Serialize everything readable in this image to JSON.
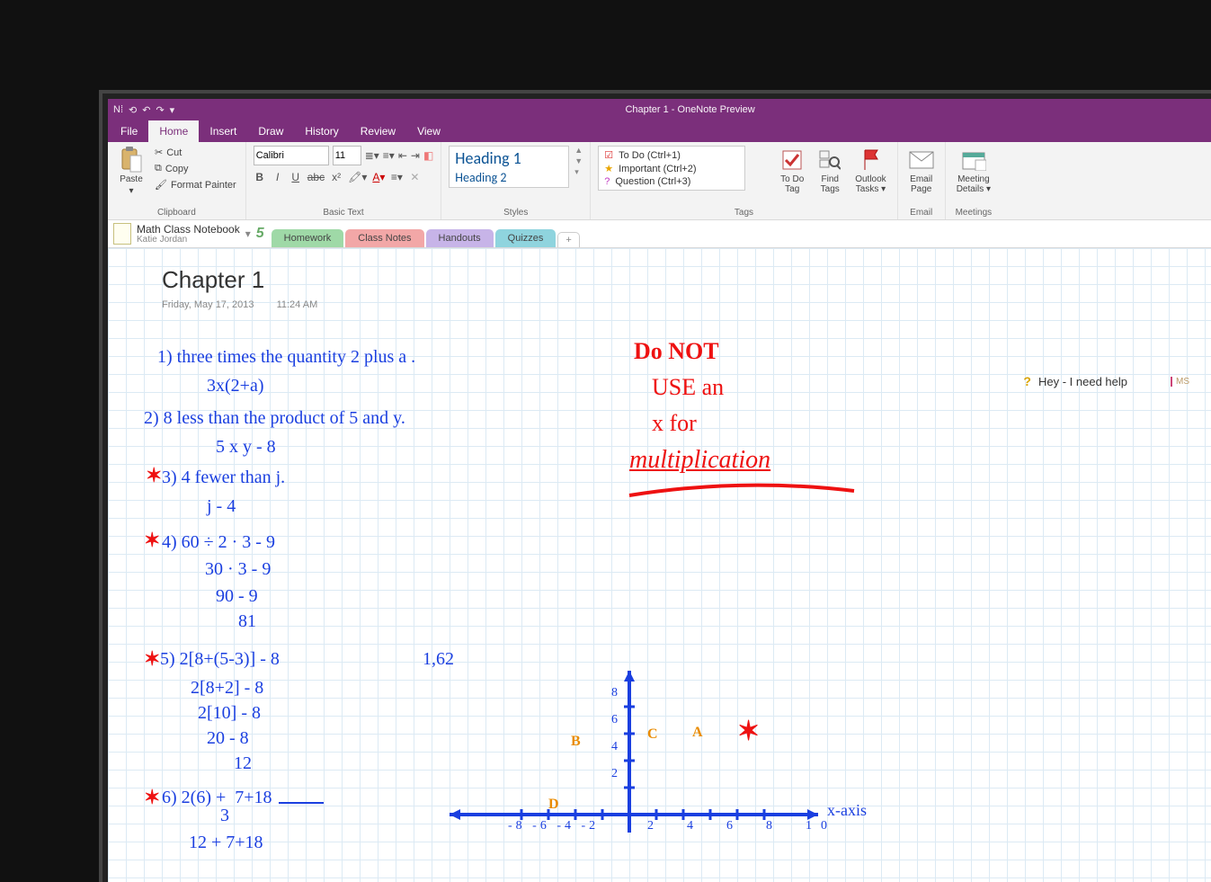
{
  "window": {
    "title": "Chapter 1  - OneNote Preview"
  },
  "ribbon_tabs": {
    "file": "File",
    "home": "Home",
    "insert": "Insert",
    "draw": "Draw",
    "history": "History",
    "review": "Review",
    "view": "View"
  },
  "clipboard": {
    "paste": "Paste",
    "cut": "Cut",
    "copy": "Copy",
    "fp": "Format Painter",
    "label": "Clipboard"
  },
  "basic_text": {
    "font": "Calibri",
    "size": "11",
    "label": "Basic Text"
  },
  "styles": {
    "h1": "Heading 1",
    "h2": "Heading 2",
    "label": "Styles"
  },
  "tags": {
    "todo": "To Do (Ctrl+1)",
    "important": "Important (Ctrl+2)",
    "question": "Question (Ctrl+3)",
    "todo_btn": "To Do\nTag",
    "find_btn": "Find\nTags",
    "outlook_btn": "Outlook\nTasks",
    "label": "Tags"
  },
  "email": {
    "btn": "Email\nPage",
    "label": "Email"
  },
  "meetings": {
    "btn": "Meeting\nDetails",
    "label": "Meetings"
  },
  "notebook": {
    "name": "Math Class Notebook",
    "owner": "Katie Jordan",
    "badge": "5"
  },
  "sections": {
    "homework": "Homework",
    "classnotes": "Class Notes",
    "handouts": "Handouts",
    "quizzes": "Quizzes",
    "add": "+"
  },
  "page": {
    "title": "Chapter 1",
    "date": "Friday, May 17, 2013",
    "time": "11:24 AM"
  },
  "ink": {
    "l1": "1) three times the quantity 2 plus a .",
    "l1b": "3x(2+a)",
    "l2": "2) 8 less than the product of 5 and y.",
    "l2b": "5 x y - 8",
    "l3": "3) 4 fewer than j.",
    "l3b": "j - 4",
    "l4": "4) 60 ÷ 2 · 3 - 9",
    "l4b": "30 · 3 - 9",
    "l4c": "90 - 9",
    "l4d": "81",
    "l5": "5) 2[8+(5-3)] - 8",
    "l5b": "2[8+2] - 8",
    "l5c": "2[10] - 8",
    "l5d": "20 - 8",
    "l5e": "12",
    "l6": "6) 2(6) +  7+18",
    "l6b": "             3",
    "l6c": "12 + 7+18",
    "extra": "1,62",
    "red1": "Do NOT",
    "red2": "USE an",
    "red3": "x for",
    "red4": "multiplication",
    "axis": "x-axis",
    "axisnums_pos": "2  4  6  8  10",
    "axisnums_neg": "-8 -6 -4 -2",
    "axisnums_y": "8\n6\n4\n2",
    "ptA": "A",
    "ptB": "B",
    "ptC": "C",
    "ptD": "D"
  },
  "side_note": {
    "text": "Hey - I need help",
    "initials": "MS"
  }
}
